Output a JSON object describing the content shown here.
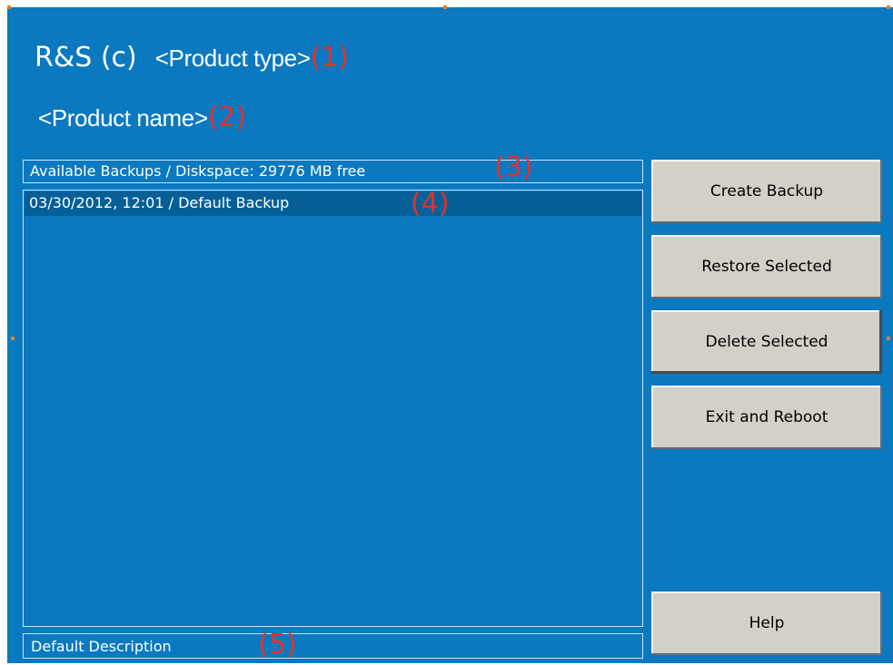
{
  "header": {
    "brand": "R&S (c)",
    "product_type": "<Product type>",
    "product_type_marker": "(1)",
    "product_name": "<Product name>",
    "product_name_marker": "(2)"
  },
  "diskspace": {
    "label": "Available Backups / Diskspace: 29776 MB free",
    "marker": "(3)"
  },
  "backups": {
    "items": [
      {
        "label": "03/30/2012, 12:01 / Default Backup",
        "selected": true
      }
    ],
    "marker": "(4)"
  },
  "description": {
    "text": "Default Description",
    "marker": "(5)"
  },
  "buttons": {
    "create_backup": "Create Backup",
    "restore_selected": "Restore Selected",
    "delete_selected": "Delete Selected",
    "exit_reboot": "Exit and Reboot",
    "help": "Help"
  },
  "colors": {
    "background": "#0a79c0",
    "selected_row": "#075f98",
    "marker": "#e5302a",
    "button_face": "#d4d0c8",
    "handles": "#e67e22"
  }
}
